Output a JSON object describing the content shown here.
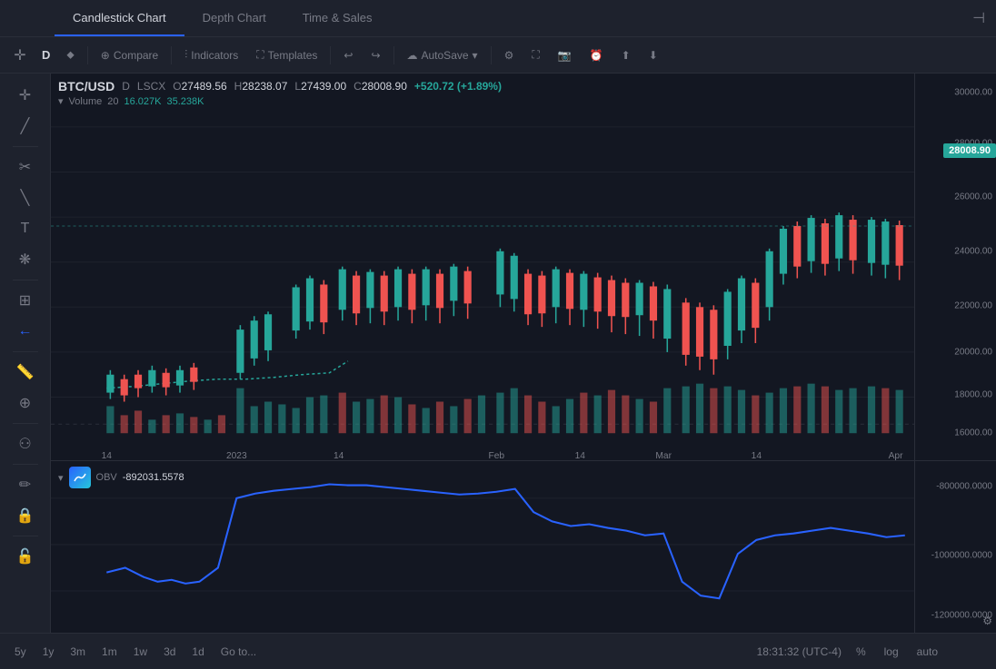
{
  "tabs": {
    "items": [
      {
        "label": "Candlestick Chart",
        "active": true
      },
      {
        "label": "Depth Chart",
        "active": false
      },
      {
        "label": "Time & Sales",
        "active": false
      }
    ]
  },
  "toolbar": {
    "timeframe": "D",
    "compare_label": "Compare",
    "indicators_label": "Indicators",
    "templates_label": "Templates",
    "autosave_label": "AutoSave"
  },
  "symbol_info": {
    "symbol": "BTC/USD",
    "timeframe": "D",
    "exchange": "LSCX",
    "open_label": "O",
    "open_value": "27489.56",
    "high_label": "H",
    "high_value": "28238.07",
    "low_label": "L",
    "low_value": "27439.00",
    "close_label": "C",
    "close_value": "28008.90",
    "change": "+520.72 (+1.89%)"
  },
  "volume_info": {
    "label": "Volume",
    "period": "20",
    "val1": "16.027K",
    "val2": "35.238K"
  },
  "obv": {
    "label": "OBV",
    "value": "-892031.5578"
  },
  "current_price": "28008.90",
  "price_levels_main": [
    "30000.00",
    "28000.00",
    "26000.00",
    "24000.00",
    "22000.00",
    "20000.00",
    "18000.00",
    "16000.00"
  ],
  "price_levels_obv": [
    "-800000.0000",
    "-1000000.0000",
    "-1200000.0000"
  ],
  "time_labels": [
    "14",
    "2023",
    "14",
    "Feb",
    "14",
    "Mar",
    "14",
    "Apr"
  ],
  "bottom": {
    "periods": [
      "5y",
      "1y",
      "3m",
      "1m",
      "1w",
      "3d",
      "1d"
    ],
    "goto": "Go to...",
    "time": "18:31:32 (UTC-4)",
    "percent": "%",
    "log": "log",
    "auto": "auto"
  },
  "colors": {
    "bullish": "#26a69a",
    "bearish": "#ef5350",
    "obv_line": "#2962ff",
    "grid": "#1e222d",
    "bg": "#131722"
  }
}
